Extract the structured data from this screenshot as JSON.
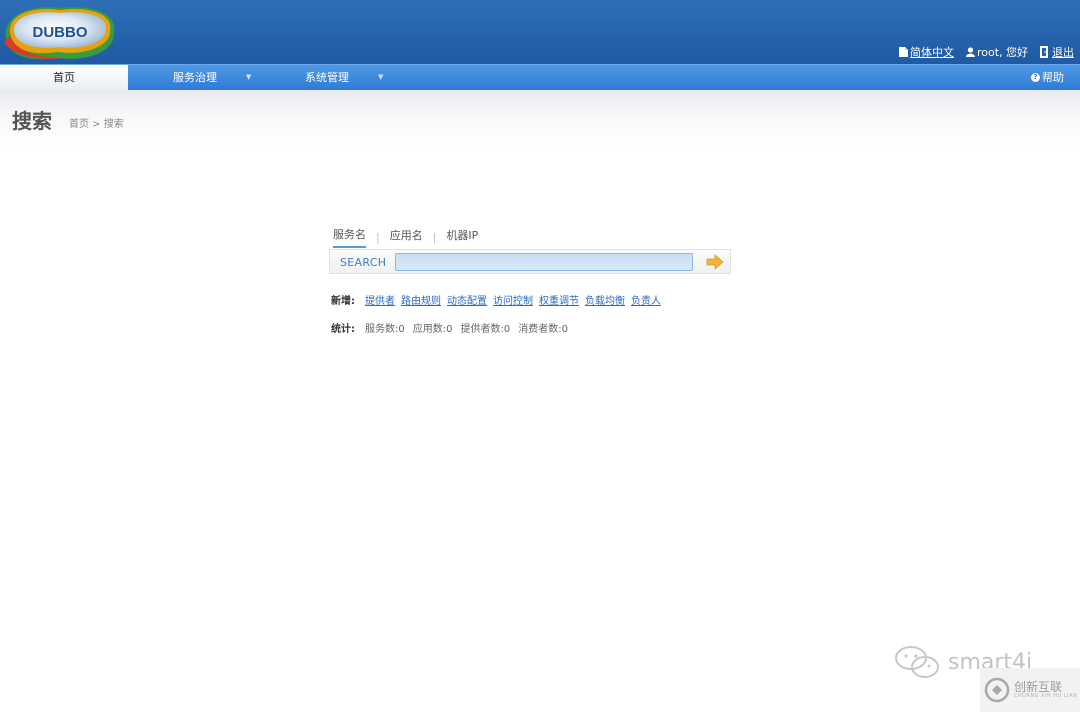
{
  "header": {
    "logo_text": "DUBBO",
    "links": {
      "language": "简体中文",
      "user": "root, 您好",
      "logout": "退出"
    }
  },
  "nav": {
    "home": "首页",
    "service_governance": "服务治理",
    "system_management": "系统管理",
    "help": "帮助"
  },
  "title": {
    "page": "搜索",
    "breadcrumb": "首页 > 搜索"
  },
  "search": {
    "tabs": [
      "服务名",
      "应用名",
      "机器IP"
    ],
    "label": "SEARCH",
    "value": "",
    "placeholder": ""
  },
  "add": {
    "label": "新增:",
    "links": [
      "提供者",
      "路由规则",
      "动态配置",
      "访问控制",
      "权重调节",
      "负载均衡",
      "负责人"
    ]
  },
  "stats": {
    "label": "统计:",
    "items": [
      "服务数:0",
      "应用数:0",
      "提供者数:0",
      "消费者数:0"
    ]
  },
  "watermark": {
    "wechat": "smart4i",
    "brand": "创新互联",
    "brand_sub": "CHUANG XIN HU LIAN"
  },
  "colors": {
    "header_blue": "#2563ad",
    "nav_blue": "#2f7bd5",
    "link_blue": "#2a6cc0",
    "search_arrow": "#f0b43c"
  }
}
